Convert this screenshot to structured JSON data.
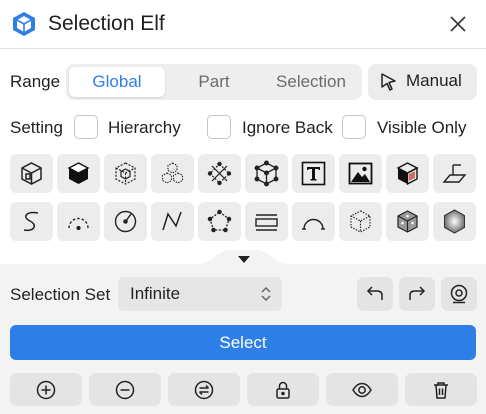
{
  "window": {
    "title": "Selection Elf",
    "logo_icon": "cube-logo-icon",
    "close_icon": "close-icon",
    "accent_color": "#2f7fe6"
  },
  "range": {
    "label": "Range",
    "options": [
      "Global",
      "Part",
      "Selection"
    ],
    "selected": "Global",
    "manual_label": "Manual",
    "manual_icon": "cursor-arrow-icon"
  },
  "settings": {
    "label": "Setting",
    "options": [
      {
        "label": "Hierarchy",
        "checked": false
      },
      {
        "label": "Ignore Back",
        "checked": false
      },
      {
        "label": "Visible Only",
        "checked": false
      }
    ]
  },
  "tools": {
    "row1": [
      "wireframe-cube-icon",
      "solid-cube-icon",
      "cube-vertices-icon",
      "cube-cluster-icon",
      "diamond-points-icon",
      "cube-corner-points-icon",
      "text-icon",
      "image-icon",
      "cube-face-icon",
      "plane-icon"
    ],
    "row2": [
      "curve-icon",
      "arc-dashed-icon",
      "circle-center-icon",
      "polyline-icon",
      "pentagon-points-icon",
      "rectangle-edges-icon",
      "arc-endpoints-icon",
      "dotted-cube-icon",
      "cube-dots-icon",
      "hexagon-gradient-icon"
    ]
  },
  "selection_set": {
    "label": "Selection Set",
    "value": "Infinite",
    "undo_icon": "undo-icon",
    "redo_icon": "redo-icon",
    "target_icon": "target-user-icon"
  },
  "select_button": {
    "label": "Select",
    "color": "#2d7fe7"
  },
  "actions": [
    "add-circle-icon",
    "remove-circle-icon",
    "swap-circle-icon",
    "lock-icon",
    "eye-icon",
    "trash-icon"
  ]
}
